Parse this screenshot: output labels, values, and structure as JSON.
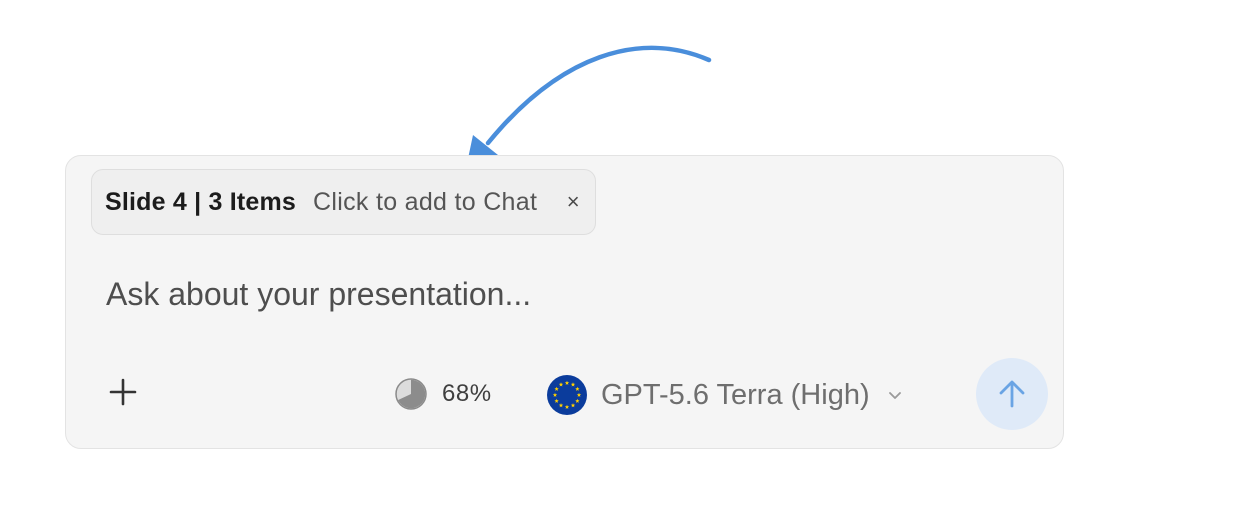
{
  "context_chip": {
    "title": "Slide 4 | 3 Items",
    "hint": "Click to add to Chat",
    "close": "×"
  },
  "prompt": {
    "placeholder": "Ask about your presentation...",
    "value": ""
  },
  "toolbar": {
    "add_icon": "plus-icon",
    "context_usage": {
      "icon": "pie-chart-icon",
      "percent": 68,
      "label": "68%"
    },
    "model": {
      "icon": "eu-flag-icon",
      "label": "GPT-5.6 Terra (High)",
      "chevron_icon": "chevron-down-icon"
    },
    "send_icon": "arrow-up-icon"
  },
  "colors": {
    "annotation_arrow": "#4a8edb",
    "send_button_bg": "#dfeaf8",
    "send_arrow": "#6aa4e4",
    "eu_blue": "#0b3c9c",
    "eu_star": "#ffd100"
  }
}
